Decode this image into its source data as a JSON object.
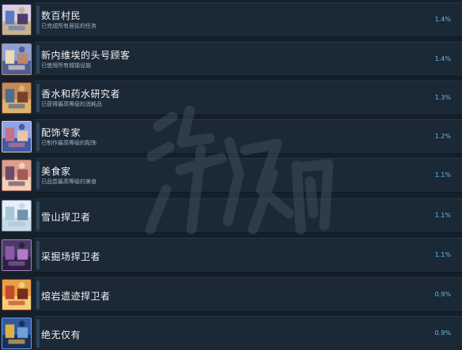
{
  "achievements": [
    {
      "title": "数百村民",
      "description": "已完成所有居民的任务",
      "percent": "1.4%",
      "icon": "villagers-icon",
      "palette": [
        "#d7cfe0",
        "#5c79c4",
        "#c9b18b",
        "#4d3a6e"
      ]
    },
    {
      "title": "新内维埃的头号顾客",
      "description": "已使用所有城镇设施",
      "percent": "1.4%",
      "icon": "town-customer-icon",
      "palette": [
        "#8d9fd6",
        "#e9d9b6",
        "#4f5d9a",
        "#b98b6d"
      ]
    },
    {
      "title": "香水和药水研究者",
      "description": "已获得最高等级的消耗品",
      "percent": "1.3%",
      "icon": "potion-researcher-icon",
      "palette": [
        "#c48a5c",
        "#4c6e8c",
        "#e0b26f",
        "#7a3e2b"
      ]
    },
    {
      "title": "配饰专家",
      "description": "已制作最高等级的配饰",
      "percent": "1.2%",
      "icon": "accessory-expert-icon",
      "palette": [
        "#8fa3e6",
        "#c4738c",
        "#3e5aa8",
        "#e6c6a8"
      ]
    },
    {
      "title": "美食家",
      "description": "已品尝最高等级的美食",
      "percent": "1.1%",
      "icon": "gourmet-icon",
      "palette": [
        "#d9a08c",
        "#6c4c6c",
        "#f0d2b4",
        "#a45a5a"
      ]
    },
    {
      "title": "雪山捍卫者",
      "description": "",
      "percent": "1.1%",
      "icon": "snow-mountain-icon",
      "palette": [
        "#e8f0f6",
        "#a9c6d9",
        "#c9dbe8",
        "#6f93b0"
      ]
    },
    {
      "title": "采掘场捍卫者",
      "description": "",
      "percent": "1.1%",
      "icon": "quarry-icon",
      "palette": [
        "#4a3a66",
        "#8c5aa8",
        "#2a2340",
        "#b07ac8"
      ]
    },
    {
      "title": "熔岩遗迹捍卫者",
      "description": "",
      "percent": "0.9%",
      "icon": "lava-ruins-icon",
      "palette": [
        "#e6a045",
        "#c44a2c",
        "#f2d07a",
        "#7a2a1c"
      ]
    },
    {
      "title": "绝无仅有",
      "description": "",
      "percent": "0.9%",
      "icon": "unique-icon",
      "palette": [
        "#2f5aa0",
        "#e0b04a",
        "#1a2f5a",
        "#6fa0d8"
      ]
    }
  ],
  "watermark": {
    "text": "游侠网"
  }
}
